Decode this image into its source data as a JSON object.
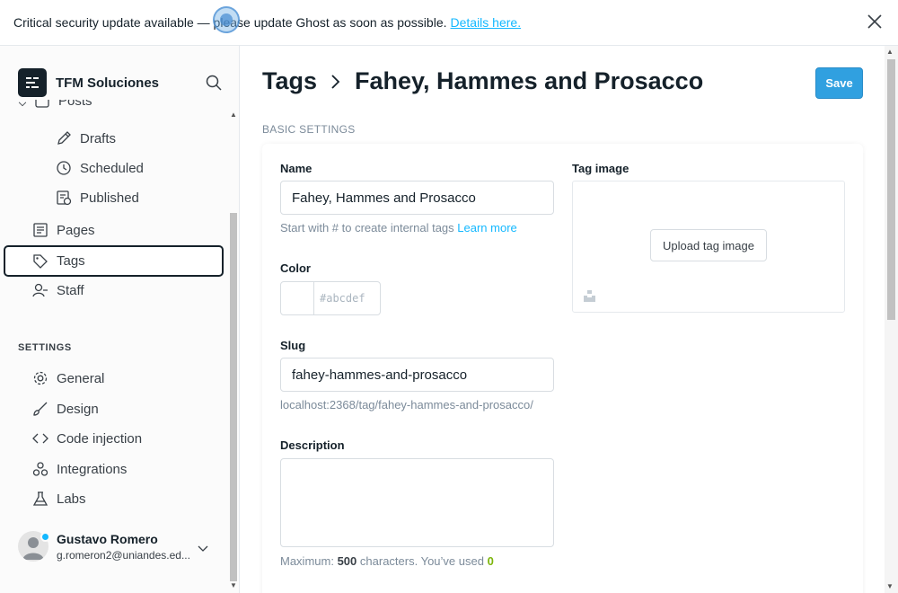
{
  "alert": {
    "message": "Critical security update available — please update Ghost as soon as possible.",
    "link_label": "Details here."
  },
  "sidebar": {
    "site_name": "TFM Soluciones",
    "posts_label": "Posts",
    "items": [
      {
        "label": "Drafts",
        "icon": "pencil-icon"
      },
      {
        "label": "Scheduled",
        "icon": "clock-icon"
      },
      {
        "label": "Published",
        "icon": "published-icon"
      },
      {
        "label": "Pages",
        "icon": "pages-icon"
      },
      {
        "label": "Tags",
        "icon": "tag-icon",
        "active": true
      },
      {
        "label": "Staff",
        "icon": "staff-icon"
      }
    ],
    "settings_title": "SETTINGS",
    "settings_items": [
      {
        "label": "General",
        "icon": "gear-icon"
      },
      {
        "label": "Design",
        "icon": "brush-icon"
      },
      {
        "label": "Code injection",
        "icon": "code-icon"
      },
      {
        "label": "Integrations",
        "icon": "integrations-icon"
      },
      {
        "label": "Labs",
        "icon": "flask-icon"
      }
    ],
    "user": {
      "name": "Gustavo Romero",
      "email": "g.romeron2@uniandes.ed..."
    }
  },
  "header": {
    "breadcrumb_parent": "Tags",
    "title": "Fahey, Hammes and Prosacco",
    "save_label": "Save"
  },
  "form": {
    "section_label": "BASIC SETTINGS",
    "name_label": "Name",
    "name_value": "Fahey, Hammes and Prosacco",
    "name_hint": "Start with # to create internal tags",
    "name_hint_link": "Learn more",
    "color_label": "Color",
    "color_hash": "#",
    "color_placeholder": "abcdef",
    "slug_label": "Slug",
    "slug_value": "fahey-hammes-and-prosacco",
    "slug_url": "localhost:2368/tag/fahey-hammes-and-prosacco/",
    "description_label": "Description",
    "description_value": "",
    "char_prefix": "Maximum:",
    "char_max": "500",
    "char_mid": "characters. You’ve used",
    "char_used": "0",
    "tag_image_label": "Tag image",
    "upload_label": "Upload tag image"
  },
  "colors": {
    "accent": "#14b8ff",
    "save_button": "#30a0e0",
    "text": "#15212a"
  }
}
